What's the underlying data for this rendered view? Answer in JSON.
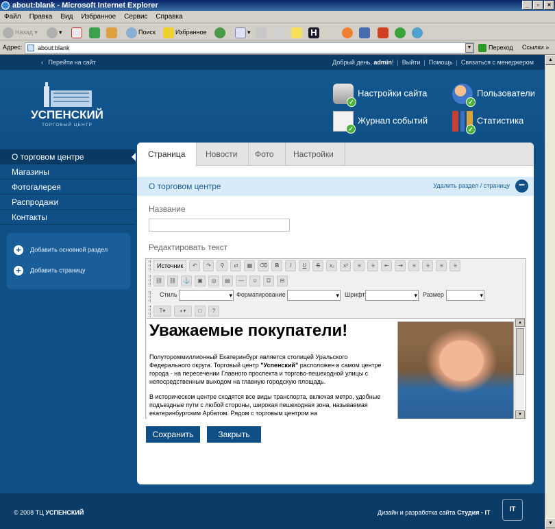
{
  "window": {
    "title": "about:blank - Microsoft Internet Explorer"
  },
  "menu": [
    "Файл",
    "Правка",
    "Вид",
    "Избранное",
    "Сервис",
    "Справка"
  ],
  "toolbar": {
    "back": "Назад",
    "search": "Поиск",
    "favorites": "Избранное"
  },
  "address": {
    "label": "Адрес:",
    "value": "about:blank",
    "go": "Переход",
    "links": "Ссылки"
  },
  "site": {
    "top": {
      "back_link": "Перейти на сайт",
      "greeting": "Добрый день,",
      "user": "admin",
      "excl": "!",
      "logout": "Выйти",
      "help": "Помощь",
      "contact": "Связаться с менеджером"
    },
    "logo": {
      "name": "УСПЕНСКИЙ",
      "subtitle": "ТОРГОВЫЙ ЦЕНТР"
    },
    "header_menu": {
      "settings": "Настройки сайта",
      "users": "Пользователи",
      "log": "Журнал событий",
      "stats": "Статистика"
    },
    "nav": [
      "О торговом центре",
      "Магазины",
      "Фотогалерея",
      "Распродажи",
      "Контакты"
    ],
    "sidebox": {
      "add_section": "Добавить основной раздел",
      "add_page": "Добавить страницу"
    },
    "tabs": [
      "Страница",
      "Новости",
      "Фото",
      "Настройки"
    ],
    "section": {
      "title": "О торговом центре",
      "delete": "Удалить раздел / страницу"
    },
    "form": {
      "name_label": "Название",
      "name_value": "",
      "edit_label": "Редактировать текст"
    },
    "editor": {
      "source": "Источник",
      "style": "Стиль",
      "format": "Форматирование",
      "font": "Шрифт",
      "size": "Размер",
      "heading": "Уважаемые покупатели!",
      "p1_a": "Полутороммиллионный Екатеринбург является столицей Уральского Федерального округа. Торговый центр ",
      "p1_b": "\"Успенский\"",
      "p1_c": " расположен в самом центре города - на пересечении Главного проспекта и торгово-пешеходной улицы с непосредственным выходом на главную городскую площадь.",
      "p2": "В историческом центре сходятся все виды транспорта, включая метро, удобные подъездные пути с любой стороны, широкая пешеходная зона, называемая екатеринбургским Арбатом. Рядом с торговым центром на"
    },
    "buttons": {
      "save": "Сохранить",
      "close": "Закрыть"
    },
    "footer": {
      "copy": "© 2008 ТЦ",
      "brand": "УСПЕНСКИЙ",
      "credit": "Дизайн и разработка сайта",
      "studio": "Студия - IT",
      "logo": "IT"
    }
  }
}
